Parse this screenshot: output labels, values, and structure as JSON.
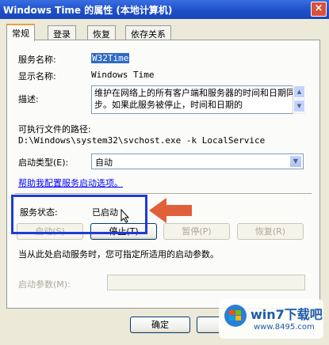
{
  "window": {
    "title": "Windows Time 的属性 (本地计算机)",
    "close_glyph": "×"
  },
  "tabs": [
    {
      "label": "常规",
      "active": true
    },
    {
      "label": "登录",
      "active": false
    },
    {
      "label": "恢复",
      "active": false
    },
    {
      "label": "依存关系",
      "active": false
    }
  ],
  "general": {
    "service_name_label": "服务名称:",
    "service_name": "W32Time",
    "display_name_label": "显示名称:",
    "display_name": "Windows Time",
    "description_label": "描述:",
    "description": "维护在网络上的所有客户端和服务器的时间和日期同步。如果此服务被停止，时间和日期的",
    "exe_path_label": "可执行文件的路径:",
    "exe_path": "D:\\Windows\\system32\\svchost.exe -k LocalService",
    "startup_type_label": "启动类型(E):",
    "startup_type": "自动",
    "help_link": "帮助我配置服务启动选项。",
    "status_label": "服务状态:",
    "status": "已启动",
    "buttons": {
      "start": "启动(S)",
      "stop": "停止(T)",
      "pause": "暂停(P)",
      "resume": "恢复(R)"
    },
    "hint": "当从此处启动服务时，您可指定所适用的启动参数。",
    "start_params_label": "启动参数(M):"
  },
  "dialog_buttons": {
    "ok": "确定"
  },
  "watermark": {
    "text": "win7下载吧",
    "url": "www.8495.com"
  },
  "colors": {
    "highlight_box": "#1e3cd6",
    "arrow": "#e0603a",
    "title_bar": "#1d4fc9"
  }
}
